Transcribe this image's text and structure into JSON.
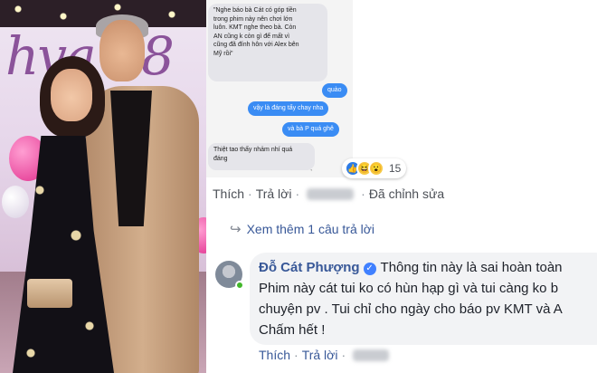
{
  "photo": {
    "backdrop_text": "hva 18",
    "description_icon": "couple-photo"
  },
  "screenshot_chat": {
    "quote_lines": [
      "\"Nghe báo bà Cát có góp tiền",
      "trong phim này nên chơi lớn",
      "luôn. KMT nghe theo bà. Còn",
      "AN cũng k còn gì để mất vì",
      "cũng đã đính hôn với Alex bên",
      "Mỹ rồi\""
    ],
    "reply_quao": "quào",
    "reply_vay": "vậy là đáng tẩy chay nha",
    "reply_bap": "và bà P quá ghê",
    "msg_thiet_lines": [
      "Thiệt tao thấy nhảm nhí quá",
      "đáng"
    ]
  },
  "reactions": {
    "icons": [
      "like-icon",
      "haha-icon",
      "wow-icon"
    ],
    "count": "15"
  },
  "first_comment_actions": {
    "like": "Thích",
    "reply": "Trả lời",
    "edited": "Đã chỉnh sửa",
    "separator": "·"
  },
  "more_replies": {
    "label": "Xem thêm 1 câu trả lời"
  },
  "reply_comment": {
    "author": "Đỗ Cát Phượng",
    "verified_icon": "verified-badge-icon",
    "lines": [
      "Thông tin này là sai hoàn toàn",
      "Phim này cát tui ko có hùn hạp gì và tui càng ko b",
      "chuyện pv . Tui chỉ cho ngày cho báo pv KMT và A",
      "Chấm hết !"
    ],
    "actions": {
      "like": "Thích",
      "reply": "Trả lời",
      "separator": "·"
    }
  },
  "colors": {
    "link_blue": "#385898",
    "bubble_blue": "#3a8cf4",
    "comment_bg": "#f2f3f5",
    "online_green": "#42b72a"
  }
}
